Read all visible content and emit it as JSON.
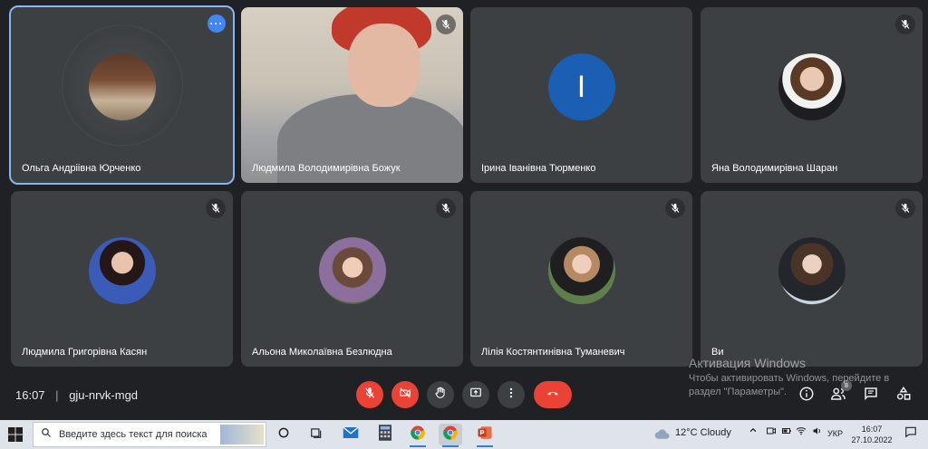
{
  "participants": [
    {
      "name": "Ольга Андріівна Юрченко",
      "muted": false,
      "active": true
    },
    {
      "name": "Людмила Володимирівна Божук",
      "muted": true,
      "video": true
    },
    {
      "name": "Ірина Іванівна Тюрменко",
      "muted": false,
      "initial": "I"
    },
    {
      "name": "Яна Володимирівна Шаран",
      "muted": true
    },
    {
      "name": "Людмила Григорівна Касян",
      "muted": true
    },
    {
      "name": "Альона Миколаївна Безлюдна",
      "muted": true
    },
    {
      "name": "Лілія Костянтинівна Туманевич",
      "muted": true
    },
    {
      "name": "Ви",
      "muted": true
    }
  ],
  "meeting": {
    "time": "16:07",
    "separator": "|",
    "code": "gju-nrvk-mgd"
  },
  "controls": {
    "participants_count": "8"
  },
  "activation": {
    "title": "Активация Windows",
    "line1": "Чтобы активировать Windows, перейдите в",
    "line2": "раздел \"Параметры\"."
  },
  "taskbar": {
    "search_placeholder": "Введите здесь текст для поиска",
    "weather": "12°C  Cloudy",
    "language": "УКР",
    "time": "16:07",
    "date": "27.10.2022"
  },
  "colors": {
    "accent": "#8ab4f8",
    "danger": "#ea4335",
    "tile": "#3c4043",
    "background": "#202124"
  }
}
